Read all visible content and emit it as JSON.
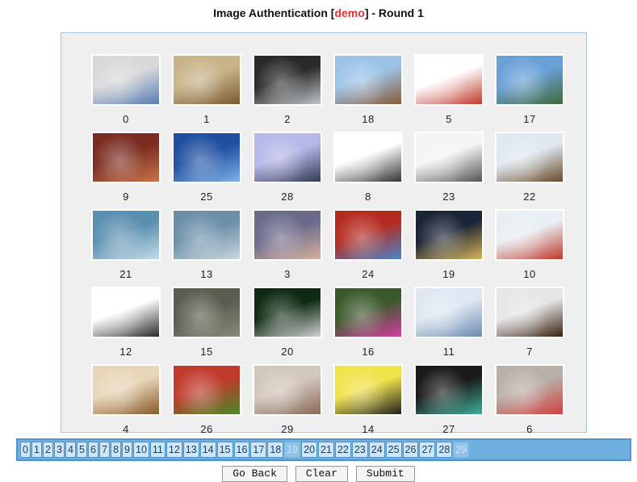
{
  "header": {
    "title_prefix": "Image Authentication [",
    "title_demo": "demo",
    "title_suffix": "] - Round 1"
  },
  "colors": {
    "demo": "#e03030",
    "panel_border": "#a9c3da",
    "numbar_bg": "#6fb0e0"
  },
  "images": [
    {
      "label": "0",
      "subject": "blue car"
    },
    {
      "label": "1",
      "subject": "dog"
    },
    {
      "label": "2",
      "subject": "silver car"
    },
    {
      "label": "18",
      "subject": "palace"
    },
    {
      "label": "5",
      "subject": "apples"
    },
    {
      "label": "17",
      "subject": "lake mountains"
    },
    {
      "label": "9",
      "subject": "pagoda"
    },
    {
      "label": "25",
      "subject": "convertible car"
    },
    {
      "label": "28",
      "subject": "flip phone"
    },
    {
      "label": "8",
      "subject": "mobile phone"
    },
    {
      "label": "23",
      "subject": "cell phone"
    },
    {
      "label": "22",
      "subject": "dog in snow"
    },
    {
      "label": "21",
      "subject": "blue abstract"
    },
    {
      "label": "13",
      "subject": "airplane"
    },
    {
      "label": "3",
      "subject": "phone with woman"
    },
    {
      "label": "24",
      "subject": "gate tower"
    },
    {
      "label": "19",
      "subject": "city night"
    },
    {
      "label": "10",
      "subject": "red phone"
    },
    {
      "label": "12",
      "subject": "silver car"
    },
    {
      "label": "15",
      "subject": "airplane ground"
    },
    {
      "label": "20",
      "subject": "dog dark"
    },
    {
      "label": "16",
      "subject": "pink flower"
    },
    {
      "label": "11",
      "subject": "snow"
    },
    {
      "label": "7",
      "subject": "dog"
    },
    {
      "label": "4",
      "subject": "airplane"
    },
    {
      "label": "26",
      "subject": "apples"
    },
    {
      "label": "29",
      "subject": "texture"
    },
    {
      "label": "14",
      "subject": "cartoon bee"
    },
    {
      "label": "27",
      "subject": "phone"
    },
    {
      "label": "6",
      "subject": "apple crates"
    }
  ],
  "numbers": [
    "0",
    "1",
    "2",
    "3",
    "4",
    "5",
    "6",
    "7",
    "8",
    "9",
    "10",
    "11",
    "12",
    "13",
    "14",
    "15",
    "16",
    "17",
    "18",
    "19",
    "20",
    "21",
    "22",
    "23",
    "24",
    "25",
    "26",
    "27",
    "28",
    "29"
  ],
  "disabled_numbers": [
    "19",
    "29"
  ],
  "buttons": {
    "go_back": "Go Back",
    "clear": "Clear",
    "submit": "Submit"
  }
}
